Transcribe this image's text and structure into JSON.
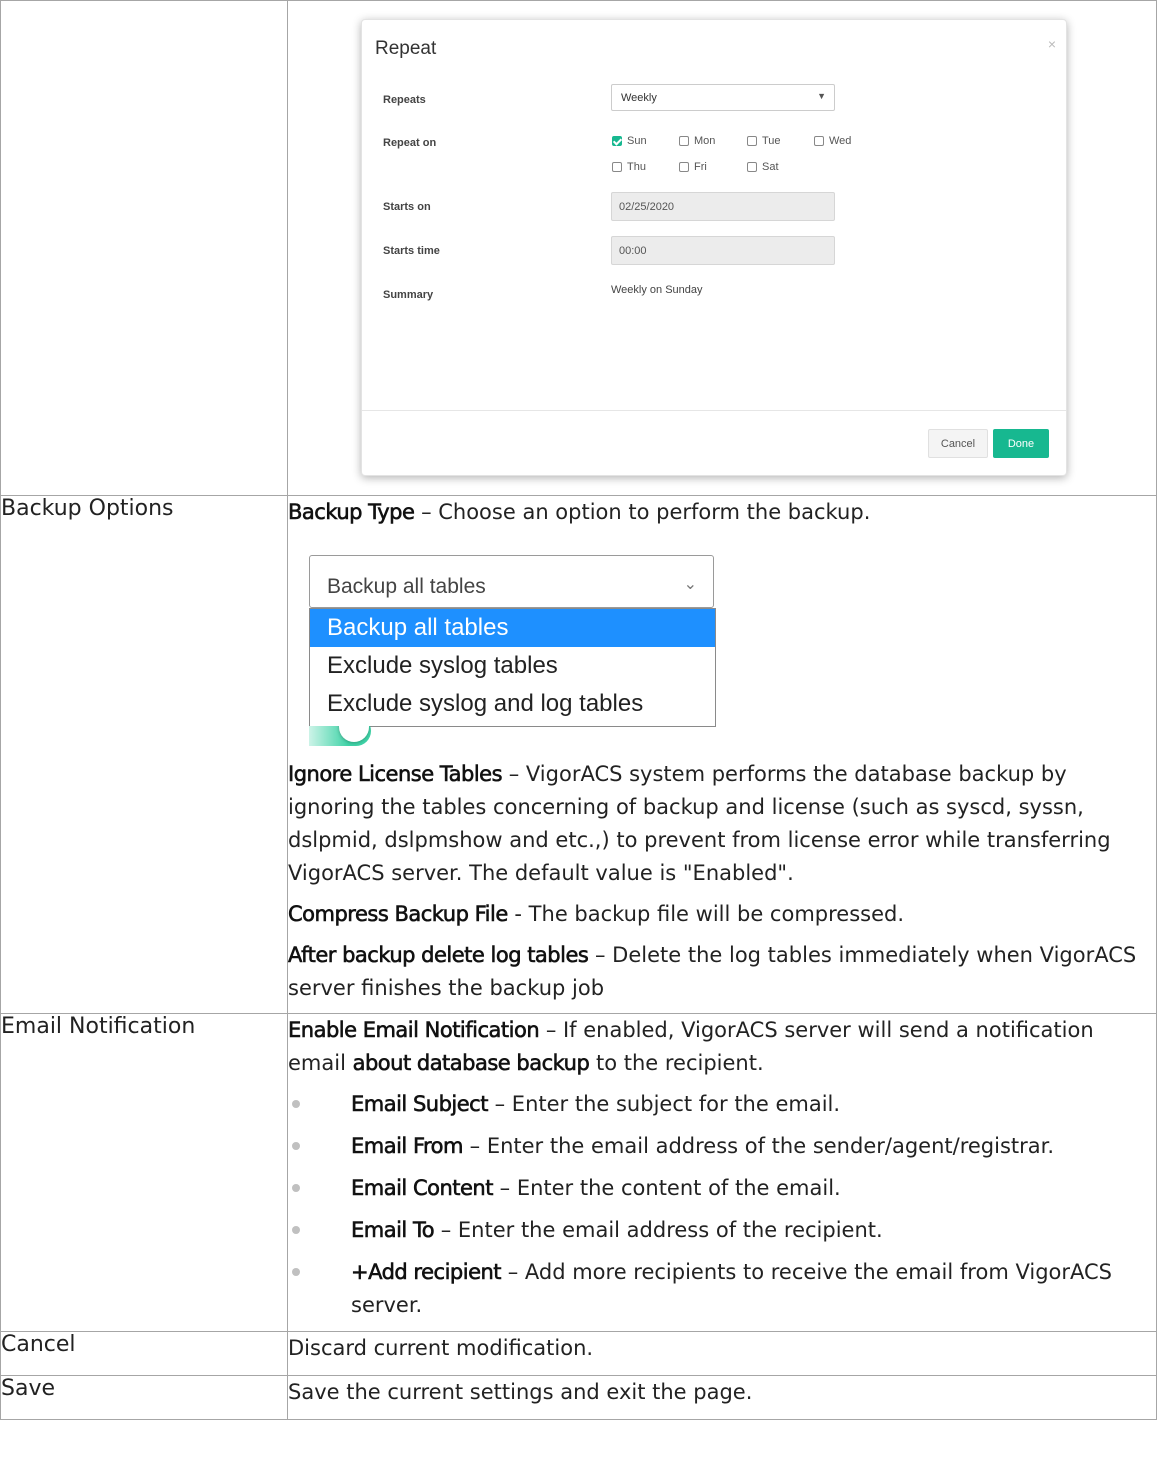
{
  "repeat_dialog": {
    "title": "Repeat",
    "close": "×",
    "repeats_label": "Repeats",
    "repeats_value": "Weekly",
    "repeat_on_label": "Repeat on",
    "days": [
      "Sun",
      "Mon",
      "Tue",
      "Wed",
      "Thu",
      "Fri",
      "Sat"
    ],
    "days_checked": [
      "Sun"
    ],
    "starts_on_label": "Starts on",
    "starts_on_value": "02/25/2020",
    "starts_time_label": "Starts time",
    "starts_time_value": "00:00",
    "summary_label": "Summary",
    "summary_value": "Weekly on Sunday",
    "cancel_label": "Cancel",
    "done_label": "Done",
    "accent": "#17b890"
  },
  "backup_options": {
    "label": "Backup Options",
    "backup_type_term": "Backup Type",
    "backup_type_text": " – Choose an option to perform the backup.",
    "dropdown_value": "Backup all tables",
    "dropdown_options": [
      "Backup all tables",
      "Exclude syslog tables",
      "Exclude syslog and log tables"
    ],
    "ignore_term": "Ignore License Tables",
    "ignore_text": " – VigorACS system performs the database backup by ignoring the tables concerning of backup and license (such as syscd, syssn, dslpmid, dslpmshow and etc.,) to prevent from license error while transferring VigorACS server. The default value is \"Enabled\".",
    "compress_term": "Compress Backup File",
    "compress_text": " - The backup file will be compressed.",
    "after_term": "After backup delete log tables",
    "after_text": " – Delete the log tables immediately when VigorACS server finishes the backup job"
  },
  "email_notification": {
    "label": "Email Notification",
    "enable_term": "Enable Email Notification",
    "enable_text_1": " – If enabled, VigorACS server will send a notification email ",
    "enable_term_2": "about database backup",
    "enable_text_2": " to the recipient.",
    "items": [
      {
        "term": "Email Subject",
        "text": " – Enter the subject for the email."
      },
      {
        "term": "Email From",
        "text": " – Enter the email address of the sender/agent/registrar."
      },
      {
        "term": "Email Content",
        "text": " – Enter the content of the email."
      },
      {
        "term": "Email To",
        "text": " – Enter the email address of the recipient."
      },
      {
        "term": "+Add recipient",
        "text": " – Add more recipients to receive the email from VigorACS server."
      }
    ]
  },
  "cancel_row": {
    "label": "Cancel",
    "text": "Discard current modification."
  },
  "save_row": {
    "label": "Save",
    "text": "Save the current settings and exit the page."
  }
}
